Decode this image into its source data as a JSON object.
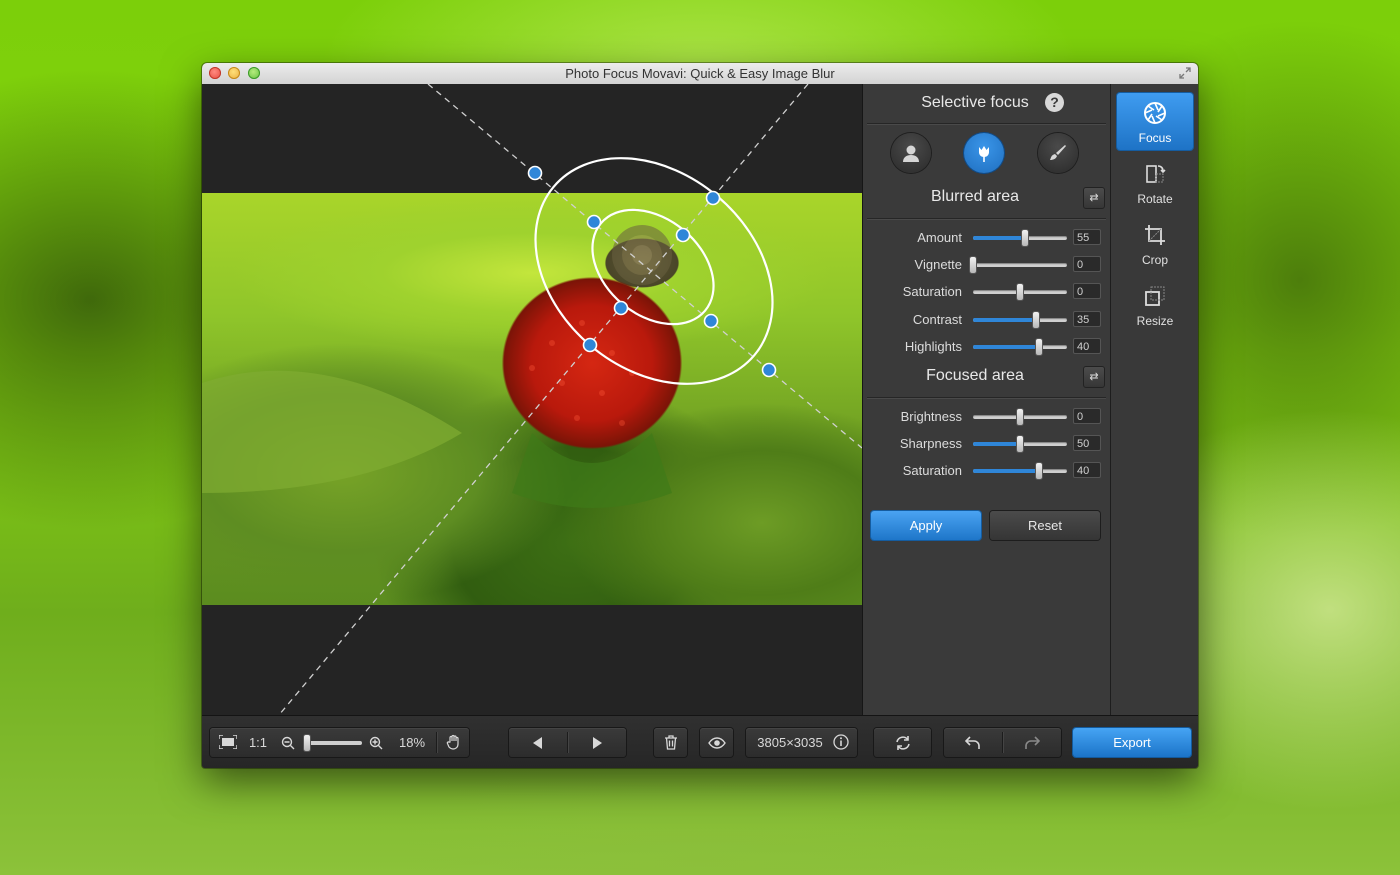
{
  "window": {
    "title": "Photo Focus Movavi: Quick & Easy Image Blur"
  },
  "panel": {
    "title": "Selective focus",
    "help_label": "?",
    "blurred_title": "Blurred area",
    "focused_title": "Focused area",
    "blurred_sliders": [
      {
        "label": "Amount",
        "value": "55",
        "level": 0.55,
        "filled": true
      },
      {
        "label": "Vignette",
        "value": "0",
        "level": 0.0,
        "filled": false
      },
      {
        "label": "Saturation",
        "value": "0",
        "level": 0.5,
        "filled": false
      },
      {
        "label": "Contrast",
        "value": "35",
        "level": 0.67,
        "filled": true
      },
      {
        "label": "Highlights",
        "value": "40",
        "level": 0.7,
        "filled": true
      }
    ],
    "focused_sliders": [
      {
        "label": "Brightness",
        "value": "0",
        "level": 0.5,
        "filled": false
      },
      {
        "label": "Sharpness",
        "value": "50",
        "level": 0.5,
        "filled": true
      },
      {
        "label": "Saturation",
        "value": "40",
        "level": 0.7,
        "filled": true
      }
    ],
    "apply_label": "Apply",
    "reset_label": "Reset"
  },
  "tools": [
    {
      "label": "Focus",
      "icon": "aperture-icon",
      "active": true
    },
    {
      "label": "Rotate",
      "icon": "rotate-icon",
      "active": false
    },
    {
      "label": "Crop",
      "icon": "crop-icon",
      "active": false
    },
    {
      "label": "Resize",
      "icon": "resize-icon",
      "active": false
    }
  ],
  "bottombar": {
    "one_to_one": "1:1",
    "zoom_percent": "18%",
    "zoom_level": 0.05,
    "dimensions": "3805×3035",
    "export_label": "Export"
  },
  "colors": {
    "accent": "#2f86d8",
    "panel": "#3a3a3a",
    "canvas": "#242424"
  }
}
